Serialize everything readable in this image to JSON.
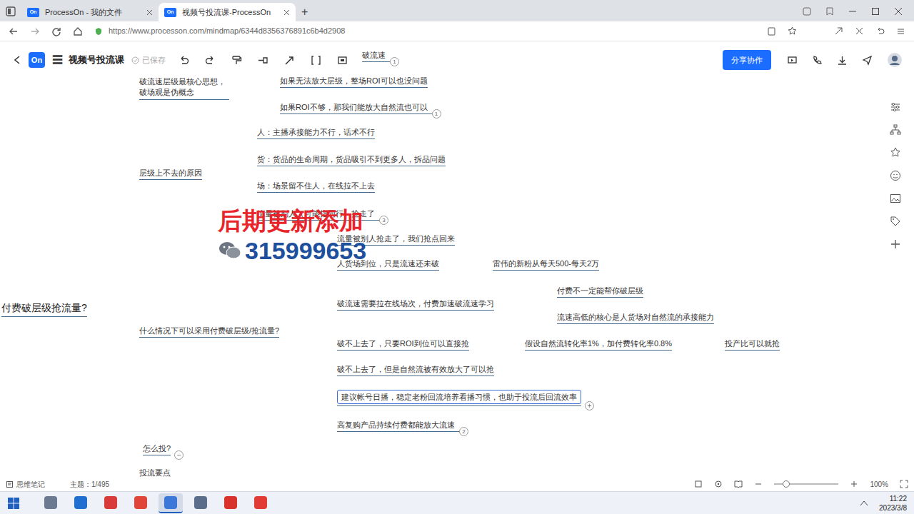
{
  "browser": {
    "tabs": [
      {
        "icon": "On",
        "label": "ProcessOn - 我的文件",
        "selected": false
      },
      {
        "icon": "On",
        "label": "视频号投流课-ProcessOn",
        "selected": true
      }
    ],
    "new_tab": "+",
    "url": "https://www.processon.com/mindmap/6344d8356376891c6b4d2908"
  },
  "toolbar": {
    "logo": "On",
    "menu": "☰",
    "title": "视频号投流课",
    "saved": "已保存",
    "share": "分享协作"
  },
  "mindmap": {
    "root": {
      "text": "付费破层级抢流量?",
      "selected": false,
      "children": [
        {
          "text": "破流速层级最核心思想，破场观是伪概念",
          "selected": false,
          "children": [
            {
              "text": "破流速",
              "badge": "1",
              "selected": false
            },
            {
              "text": "如果无法放大层级，整场ROI可以也没问题",
              "selected": false
            },
            {
              "text": "如果ROI不够，那我们能放大自然流也可以",
              "badge": "1",
              "selected": false
            }
          ]
        },
        {
          "text": "层级上不去的原因",
          "selected": false,
          "children": [
            {
              "text": "人：主播承接能力不行，话术不行",
              "selected": false
            },
            {
              "text": "货：货品的生命周期，货品吸引不到更多人，拆品问题",
              "selected": false
            },
            {
              "text": "场：场景留不住人，在线拉不上去",
              "selected": false
            },
            {
              "text": "流量被别人（可能指同行）抢走了",
              "badge": "3",
              "selected": false
            }
          ]
        },
        {
          "text": "什么情况下可以采用付费破层级/抢流量?",
          "selected": false,
          "children": [
            {
              "text": "流量被别人抢走了，我们抢点回来",
              "selected": false
            },
            {
              "text": "人货场到位，只是流速还未破",
              "selected": false,
              "children": [
                {
                  "text": "雷伟的新粉从每天500-每天2万",
                  "selected": false
                }
              ]
            },
            {
              "text": "破流速需要拉在线场次，付费加速破流速学习",
              "selected": false,
              "children": [
                {
                  "text": "付费不一定能帮你破层级",
                  "selected": false
                },
                {
                  "text": "流速高低的核心是人货场对自然流的承接能力",
                  "selected": false
                }
              ]
            },
            {
              "text": "破不上去了，只要ROI到位可以直接抢",
              "selected": false,
              "children": [
                {
                  "text": "假设自然流转化率1%，加付费转化率0.8%",
                  "selected": false,
                  "children": [
                    {
                      "text": "投产比可以就抢",
                      "selected": false
                    }
                  ]
                }
              ]
            },
            {
              "text": "破不上去了，但是自然流被有效放大了可以抢",
              "selected": false
            },
            {
              "text": "建议帐号日播，稳定老粉回流培养看播习惯，也助于投流后回流效率",
              "selected": true,
              "toggle": "+"
            },
            {
              "text": "高复购产品持续付费都能放大流速",
              "badge": "2",
              "selected": false
            }
          ]
        },
        {
          "text": "怎么投?",
          "selected": false,
          "toggle": "−"
        },
        {
          "text": "投流要点",
          "selected": false
        }
      ]
    }
  },
  "watermark": {
    "title": "后期更新添加",
    "contact": "315999653"
  },
  "status_bar": {
    "notes": "思维笔记",
    "topics": "主题：1/495",
    "zoom": "100%"
  },
  "taskbar": {
    "apps": [
      {
        "color": "#6b7a90",
        "selected": false
      },
      {
        "color": "#1f6fd0",
        "selected": false
      },
      {
        "color": "#d93a3a",
        "selected": false
      },
      {
        "color": "#e0453a",
        "selected": false
      },
      {
        "color": "#3c78d8",
        "selected": true
      },
      {
        "color": "#5a6e8c",
        "selected": false
      },
      {
        "color": "#d8322b",
        "selected": false
      },
      {
        "color": "#e23b33",
        "selected": false
      }
    ],
    "time": "11:22",
    "date": "2023/3/8"
  }
}
